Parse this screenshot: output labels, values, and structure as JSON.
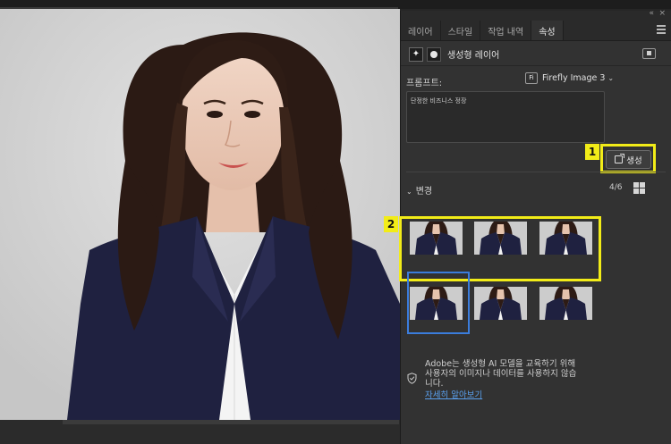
{
  "panel": {
    "tabs": [
      {
        "label": "레이어",
        "active": false
      },
      {
        "label": "스타일",
        "active": false
      },
      {
        "label": "작업 내역",
        "active": false
      },
      {
        "label": "속성",
        "active": true
      }
    ],
    "collapse_glyph": "«",
    "close_glyph": "×"
  },
  "layer": {
    "title": "생성형 레이어",
    "sparkle_glyph": "✦"
  },
  "prompt": {
    "label": "프롬프트:",
    "model_badge": "Fi",
    "model": "Firefly Image 3",
    "model_chevron": "⌄",
    "text": "단정한 비즈니스 정장"
  },
  "generate": {
    "label": "생성",
    "badge": "1"
  },
  "variations": {
    "label": "변경",
    "chevron": "⌄",
    "count": "4/6",
    "badge": "2",
    "thumbnails": [
      {
        "row": 1,
        "col": 1
      },
      {
        "row": 1,
        "col": 2
      },
      {
        "row": 1,
        "col": 3
      },
      {
        "row": 2,
        "col": 1,
        "selected": true
      },
      {
        "row": 2,
        "col": 2
      },
      {
        "row": 2,
        "col": 3
      }
    ]
  },
  "info": {
    "text": "Adobe는 생성형 AI 모델을 교육하기 위해 사용자의 이미지나 데이터를 사용하지 않습니다.",
    "link": "자세히 알아보기"
  },
  "colors": {
    "highlight": "#f2ec18",
    "selection": "#3b7ddc",
    "link": "#5aa0ee",
    "suit": "#1f2140",
    "panel_bg": "#323232"
  }
}
